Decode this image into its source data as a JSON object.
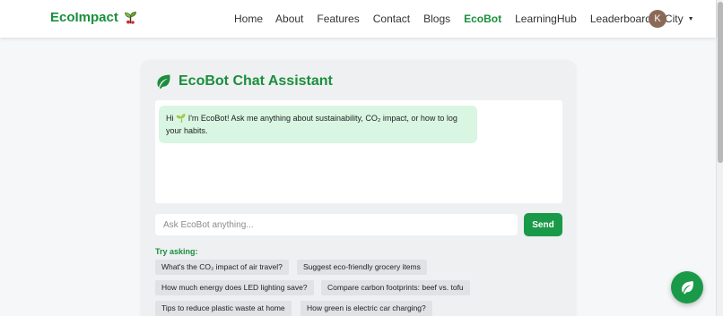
{
  "navbar": {
    "brand": "EcoImpact",
    "brand_icon": "sprout-icon",
    "links": [
      {
        "label": "Home",
        "active": false
      },
      {
        "label": "About",
        "active": false
      },
      {
        "label": "Features",
        "active": false
      },
      {
        "label": "Contact",
        "active": false
      },
      {
        "label": "Blogs",
        "active": false
      },
      {
        "label": "EcoBot",
        "active": true
      },
      {
        "label": "LearningHub",
        "active": false
      },
      {
        "label": "Leaderboard",
        "active": false
      }
    ],
    "city_label": "City",
    "avatar_initial": "K"
  },
  "chat": {
    "title": "EcoBot Chat Assistant",
    "title_icon": "leaf-icon",
    "bot_message": "Hi 🌱 I'm EcoBot! Ask me anything about sustainability, CO₂ impact, or how to log your habits.",
    "input_placeholder": "Ask EcoBot anything...",
    "send_label": "Send",
    "try_label": "Try asking:",
    "suggestions": [
      "What's the CO₂ impact of air travel?",
      "Suggest eco-friendly grocery items",
      "How much energy does LED lighting save?",
      "Compare carbon footprints: beef vs. tofu",
      "Tips to reduce plastic waste at home",
      "How green is electric car charging?"
    ]
  },
  "fab_icon": "leaf-icon",
  "colors": {
    "accent": "#1a8f3c",
    "button": "#1a9a48",
    "bubble": "#d9f6e2",
    "card": "#eef0f2",
    "avatar": "#8a6a57"
  }
}
